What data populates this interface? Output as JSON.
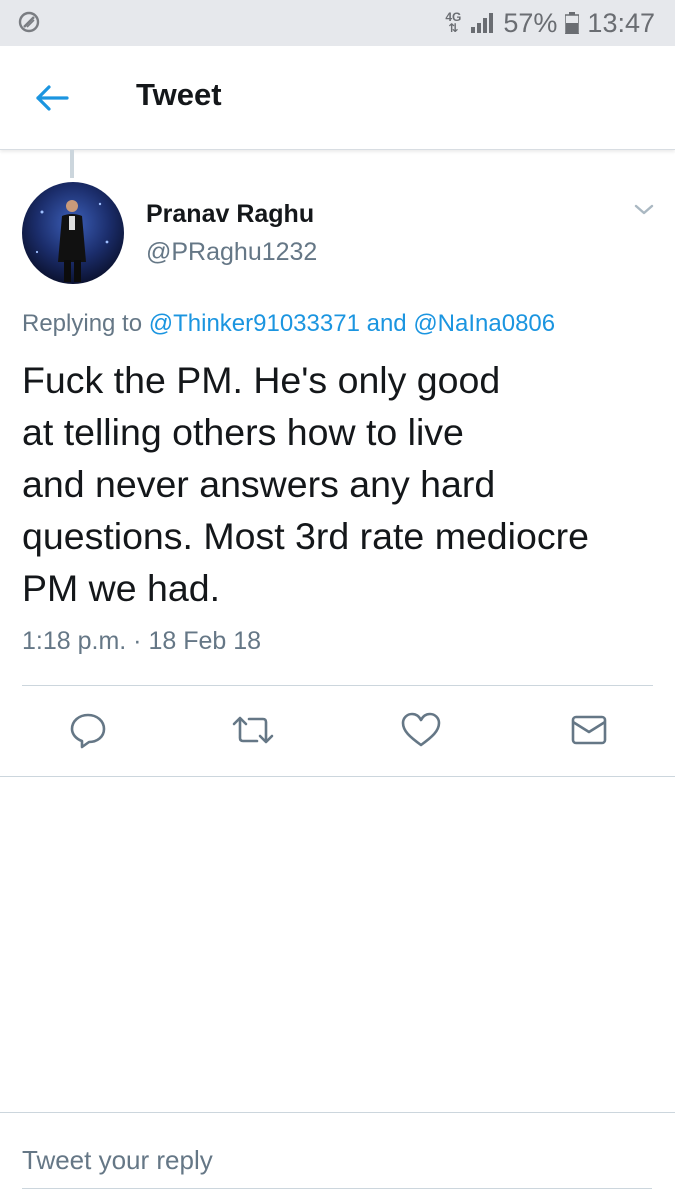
{
  "status_bar": {
    "network": "4G",
    "battery": "57%",
    "time": "13:47"
  },
  "header": {
    "title": "Tweet",
    "back_icon": "arrow-left-icon"
  },
  "tweet": {
    "display_name": "Pranav Raghu",
    "handle": "@PRaghu1232",
    "replying_prefix": "Replying to",
    "mention_1": "@Thinker91033371",
    "replying_and": "and",
    "mention_2": "@NaIna0806",
    "text_lines": [
      "Fuck the PM. He's only good",
      "at telling others how to live",
      "and never answers any hard",
      "questions. Most 3rd rate mediocre",
      "PM we had."
    ],
    "timestamp": "1:18 p.m. · 18 Feb 18"
  },
  "actions": [
    "reply-icon",
    "retweet-icon",
    "like-icon",
    "direct-message-icon"
  ],
  "reply_box": {
    "placeholder": "Tweet your reply"
  },
  "colors": {
    "accent": "#1b95e0",
    "secondary_text": "#657786",
    "status_bar_bg": "#e6e8ec"
  }
}
